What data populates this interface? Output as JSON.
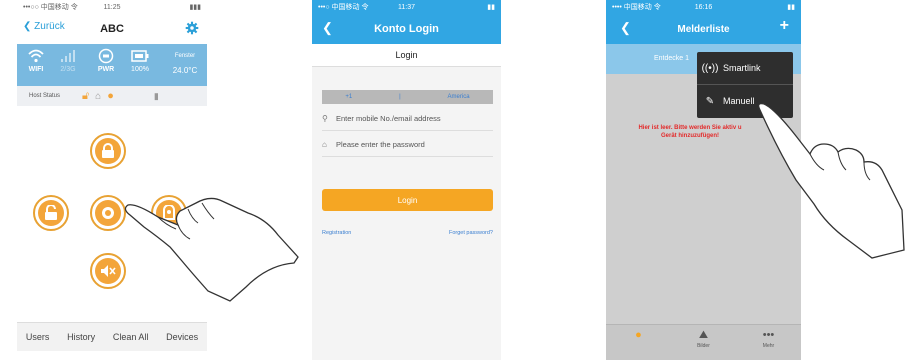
{
  "phone1": {
    "status": {
      "carrier": "•••○○ 中国移动 令",
      "time": "11:25"
    },
    "nav": {
      "back_label": "Zurück",
      "title": "ABC",
      "settings_icon": "gear-icon"
    },
    "info": {
      "wifi": "WIFI",
      "gsm": "2/3G",
      "pwr": "PWR",
      "battery": "100%",
      "sensor_label": "Fenster",
      "temperature": "24.0°C"
    },
    "host_status_label": "Host Status",
    "tabs": [
      "Users",
      "History",
      "Clean All",
      "Devices"
    ],
    "accent": "#f3a53a"
  },
  "phone2": {
    "status": {
      "carrier": "•••○ 中国移动 令",
      "time": "11:37"
    },
    "nav": {
      "title": "Konto Login"
    },
    "page_title": "Login",
    "country": {
      "code": "+1",
      "separator": "|",
      "name": "America"
    },
    "mobile_placeholder": "Enter mobile No./email address",
    "password_placeholder": "Please enter the password",
    "login_button": "Login",
    "registration_link": "Registration",
    "forgot_link": "Forget password?",
    "accent": "#31a6e3",
    "button_color": "#f5a623"
  },
  "phone3": {
    "status": {
      "carrier": "•••• 中国移动 令",
      "time": "16:16"
    },
    "nav": {
      "title": "Melderliste",
      "add_icon": "plus-icon"
    },
    "discover_text": "Entdecke 1",
    "menu": [
      {
        "label": "Smartlink",
        "icon": "broadcast-icon"
      },
      {
        "label": "Manuell",
        "icon": "pen-icon"
      }
    ],
    "empty_message_line1": "Hier ist leer. Bitte werden Sie aktiv u",
    "empty_message_line2": "Gerät hinzuzufügen!",
    "tabs": [
      {
        "label": "",
        "icon": "person-icon"
      },
      {
        "label": "Bilder",
        "icon": "picture-icon"
      },
      {
        "label": "Mehr",
        "icon": "more-icon"
      }
    ],
    "warning_color": "#e32a2a"
  }
}
